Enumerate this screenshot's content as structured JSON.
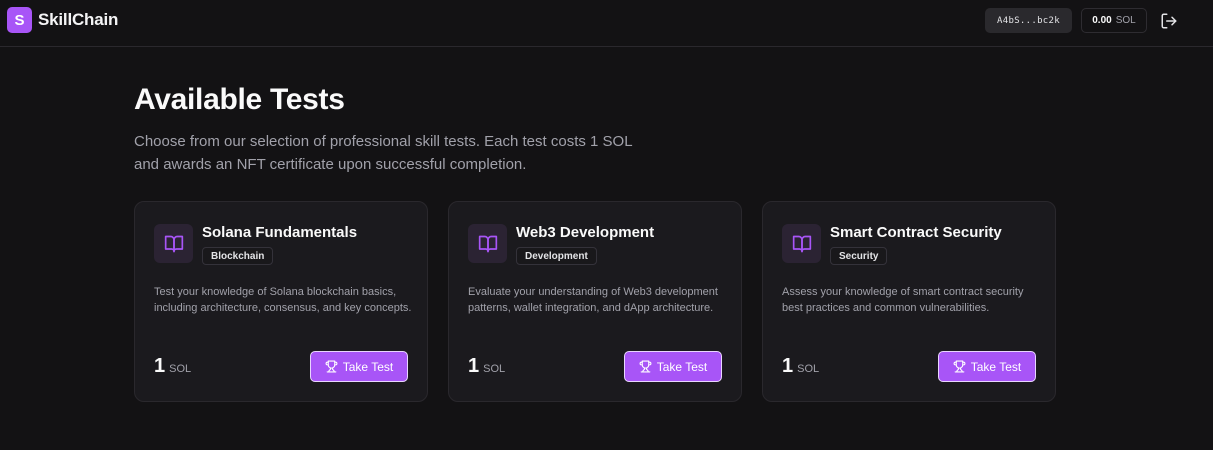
{
  "brand": {
    "logo_letter": "S",
    "name": "SkillChain",
    "accent": "#a855f7"
  },
  "header": {
    "wallet_address": "A4bS...bc2k",
    "balance_amount": "0.00",
    "balance_unit": "SOL"
  },
  "page": {
    "title": "Available Tests",
    "subtitle_line1": "Choose from our selection of professional skill tests. Each test costs 1 SOL",
    "subtitle_line2": "and awards an NFT certificate upon successful completion."
  },
  "tests": [
    {
      "title": "Solana Fundamentals",
      "category": "Blockchain",
      "description": "Test your knowledge of Solana blockchain basics, including architecture, consensus, and key concepts.",
      "price": "1",
      "unit": "SOL",
      "button": "Take Test",
      "icon": "book-icon"
    },
    {
      "title": "Web3 Development",
      "category": "Development",
      "description": "Evaluate your understanding of Web3 development patterns, wallet integration, and dApp architecture.",
      "price": "1",
      "unit": "SOL",
      "button": "Take Test",
      "icon": "book-icon"
    },
    {
      "title": "Smart Contract Security",
      "category": "Security",
      "description": "Assess your knowledge of smart contract security best practices and common vulnerabilities.",
      "price": "1",
      "unit": "SOL",
      "button": "Take Test",
      "icon": "book-icon"
    }
  ]
}
